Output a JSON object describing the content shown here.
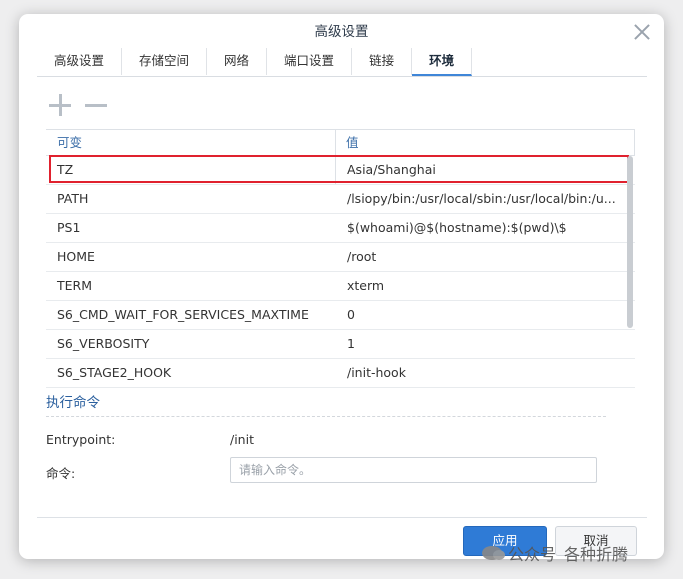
{
  "dialog": {
    "title": "高级设置"
  },
  "tabs": [
    {
      "label": "高级设置"
    },
    {
      "label": "存储空间"
    },
    {
      "label": "网络"
    },
    {
      "label": "端口设置"
    },
    {
      "label": "链接"
    },
    {
      "label": "环境",
      "active": true
    }
  ],
  "toolbar": {
    "add_icon": "plus-icon",
    "remove_icon": "minus-icon"
  },
  "grid": {
    "headers": {
      "variable": "可变",
      "value": "值"
    },
    "rows": [
      {
        "var": "TZ",
        "val": "Asia/Shanghai"
      },
      {
        "var": "PATH",
        "val": "/lsiopy/bin:/usr/local/sbin:/usr/local/bin:/u..."
      },
      {
        "var": "PS1",
        "val": "$(whoami)@$(hostname):$(pwd)\\$"
      },
      {
        "var": "HOME",
        "val": "/root"
      },
      {
        "var": "TERM",
        "val": "xterm"
      },
      {
        "var": "S6_CMD_WAIT_FOR_SERVICES_MAXTIME",
        "val": "0"
      },
      {
        "var": "S6_VERBOSITY",
        "val": "1"
      },
      {
        "var": "S6_STAGE2_HOOK",
        "val": "/init-hook"
      }
    ]
  },
  "exec": {
    "section_title": "执行命令",
    "entrypoint_label": "Entrypoint:",
    "entrypoint_value": "/init",
    "command_label": "命令:",
    "command_placeholder": "请输入命令。"
  },
  "footer": {
    "apply_label": "应用",
    "cancel_label": "取消"
  },
  "watermark": {
    "text1": "公众号",
    "text2": "各种折腾"
  },
  "colors": {
    "accent": "#2f7bd6",
    "highlight": "#e0212e"
  }
}
